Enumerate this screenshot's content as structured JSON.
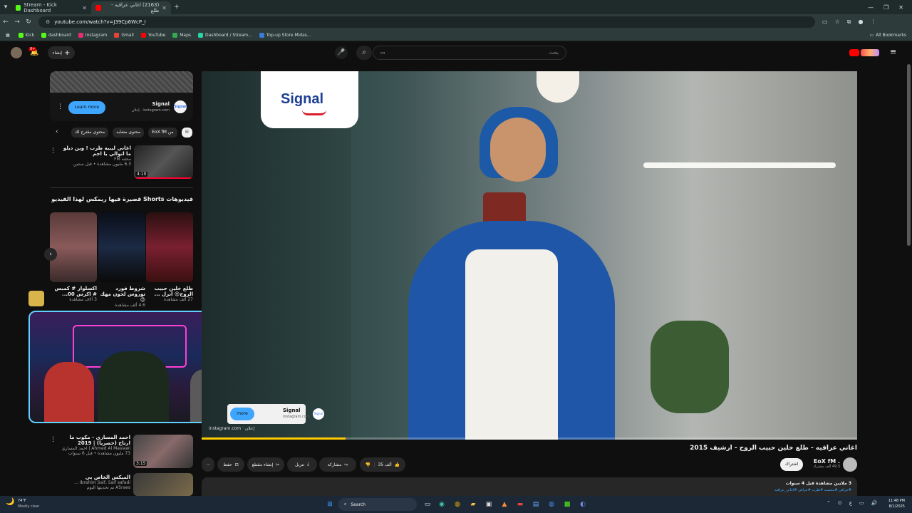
{
  "browser": {
    "tabs": [
      {
        "label": "Stream - Kick Dashboard",
        "active": false
      },
      {
        "label": "(2163) اغاني عراقيه - طلع",
        "active": true
      }
    ],
    "url": "youtube.com/watch?v=J39Cp6WcP_I",
    "bookmarks": [
      "Kick",
      "dashboard",
      "Instagram",
      "Gmail",
      "YouTube",
      "Maps",
      "Dashboard / Stream...",
      "Top-up Store Midas..."
    ],
    "all_bookmarks": "All Bookmarks",
    "colors": {
      "kick": "#53fc18",
      "youtube": "#ff0000",
      "instagram": "#e1306c",
      "gmail": "#ea4335"
    }
  },
  "youtube": {
    "search_placeholder": "بحث",
    "create_label": "إنشاء",
    "notification_count": "9+"
  },
  "ad": {
    "title": "Signal",
    "domain": "instagram.com",
    "sponsored": "إعلان",
    "cta": "Learn more"
  },
  "chips": [
    "من EoX fM",
    "محتوى مشابه",
    "محتوى مقترح لك"
  ],
  "related_top": {
    "title": "اغاني ليبية طرب ! وين ديلو ما انوالي يا اجم",
    "channel": "محفه FM",
    "views": "6.3 مليون مشاهدة • قبل سنتين",
    "duration": "4:10"
  },
  "shorts": {
    "section_title": "فيديوهات Shorts قصيرة فيها ريمكس لهذا الفيديو",
    "items": [
      {
        "title": "طلع خلين حبيب الروح😍 انزل ...",
        "views": "27 ألف مشاهدة"
      },
      {
        "title": "شروط فورد توروس لحون مهك 😍",
        "views": "4.6 ألف مشاهدة"
      },
      {
        "title": "اكسلوار # كمبس # اكرس 00...",
        "views": "3 آلاف مشاهدة"
      }
    ]
  },
  "related_bottom": [
    {
      "title": "احمد المساري - مكوب ما ارتاح (حصريا) | 2019",
      "channel": "Ahmed Al Masiawi | احمد المساري",
      "views": "73 مليون مشاهدة • قبل 6 سنوات",
      "duration": "3:15"
    },
    {
      "title": "الميكس الخاص بي",
      "channel": "Ibrahim Saif, Saif safadi ...",
      "views": "A5raes تم تحديثها اليوم"
    }
  ],
  "overlay_ad": {
    "title": "Signal",
    "domain": "instagram.com",
    "button": "more",
    "sponsored": "إعلان"
  },
  "video": {
    "brand_logo": "Signal",
    "title": "اغاني عراقيه - طلع خلين حبيب الروح - ارشيف 2015",
    "channel": "EoX fM .",
    "subscribers": "49.3 ألف مشترك",
    "subscribe": "اشتراك",
    "likes": "35 ألف",
    "share": "مشاركة",
    "download": "تنزيل",
    "clip": "إنشاء مقطع",
    "save": "حفظ",
    "views_line": "3 ملايين مشاهدة قبل 4 سنوات",
    "tags_line": "#عراقي #محسبه #طرب #عراقي #اغاني_عراقيه",
    "progress": 0.22
  },
  "taskbar": {
    "weather_temp": "74°F",
    "weather_desc": "Mostly clear",
    "search": "Search",
    "time": "11:48 PM",
    "date": "8/1/2025"
  }
}
